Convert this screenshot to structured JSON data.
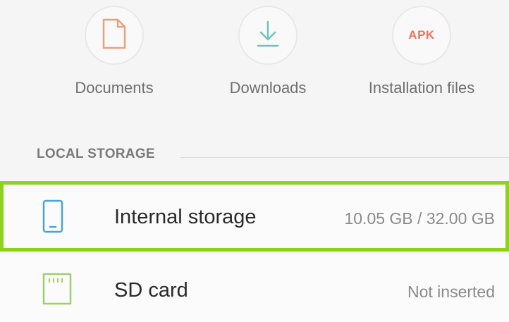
{
  "categories": [
    {
      "label": "Documents",
      "icon": "document-icon",
      "color": "#e9a27e"
    },
    {
      "label": "Downloads",
      "icon": "download-icon",
      "color": "#6fc3c0"
    },
    {
      "label": "Installation files",
      "icon": "apk-icon",
      "badge": "APK",
      "color": "#e9745d"
    }
  ],
  "section": {
    "local_storage": "LOCAL STORAGE"
  },
  "storage": [
    {
      "name": "Internal storage",
      "detail": "10.05 GB / 32.00 GB",
      "icon": "phone-icon",
      "highlighted": true,
      "highlight_color": "#8ed21f"
    },
    {
      "name": "SD card",
      "detail": "Not inserted",
      "icon": "sd-card-icon"
    }
  ]
}
